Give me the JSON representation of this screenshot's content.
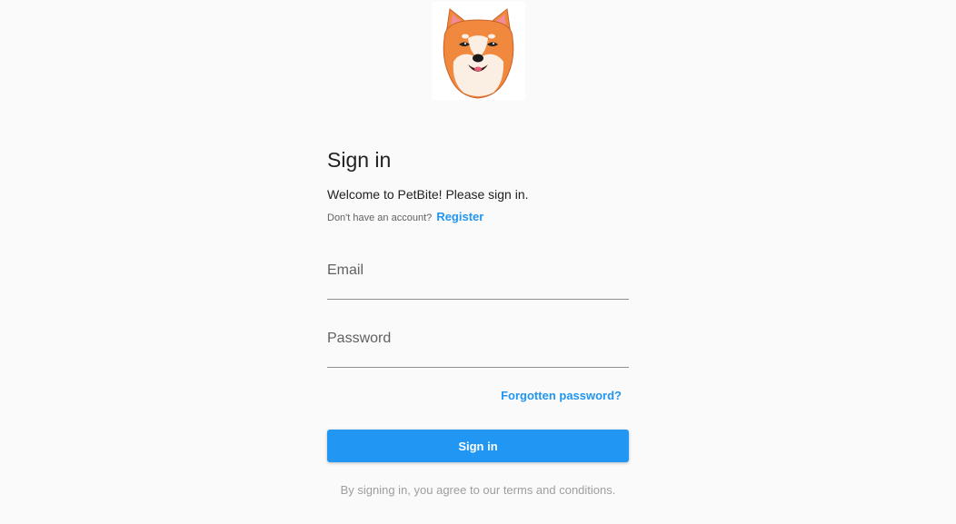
{
  "logo": {
    "alt": "PetBite shiba inu logo"
  },
  "header": {
    "title": "Sign in"
  },
  "intro": {
    "welcome": "Welcome to PetBite! Please sign in.",
    "no_account": "Don't have an account?",
    "register_label": "Register"
  },
  "form": {
    "email_label": "Email",
    "email_value": "",
    "password_label": "Password",
    "password_value": "",
    "forgot_label": "Forgotten password?",
    "submit_label": "Sign in"
  },
  "footer": {
    "terms": "By signing in, you agree to our terms and conditions."
  },
  "colors": {
    "accent": "#2196f3",
    "background": "#fafafa",
    "logo_orange": "#f0883e"
  }
}
